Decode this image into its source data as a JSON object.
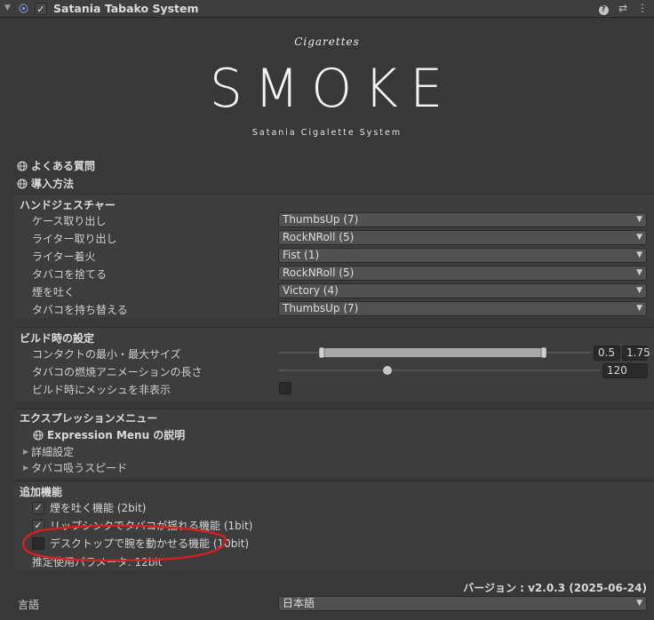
{
  "header": {
    "title": "Satania Tabako System",
    "enabled": true,
    "icons": [
      "help-icon",
      "preset-icon",
      "more-icon"
    ]
  },
  "logo": {
    "script_text": "Cigarettes",
    "main_text": "SMOKE",
    "sub_text": "Satania Cigalette System"
  },
  "links": {
    "faq": "よくある質問",
    "install": "導入方法"
  },
  "hand_gesture": {
    "title": "ハンドジェスチャー",
    "rows": [
      {
        "label": "ケース取り出し",
        "value": "ThumbsUp (7)"
      },
      {
        "label": "ライター取り出し",
        "value": "RockNRoll (5)"
      },
      {
        "label": "ライター着火",
        "value": "Fist (1)"
      },
      {
        "label": "タバコを捨てる",
        "value": "RockNRoll (5)"
      },
      {
        "label": "煙を吐く",
        "value": "Victory (4)"
      },
      {
        "label": "タバコを持ち替える",
        "value": "ThumbsUp (7)"
      }
    ]
  },
  "build": {
    "title": "ビルド時の設定",
    "contact_label": "コンタクトの最小・最大サイズ",
    "contact_min": "0.5",
    "contact_max": "1.75",
    "burn_label": "タバコの燃焼アニメーションの長さ",
    "burn_value": "120",
    "hide_mesh_label": "ビルド時にメッシュを非表示"
  },
  "expression": {
    "title": "エクスプレッションメニュー",
    "menu_link": "Expression Menu の説明",
    "foldouts": [
      "詳細設定",
      "タバコ吸うスピード"
    ]
  },
  "extra": {
    "title": "追加機能",
    "items": [
      {
        "label": "煙を吐く機能 (2bit)",
        "checked": true
      },
      {
        "label": "リップシンクでタバコが揺れる機能 (1bit)",
        "checked": true
      },
      {
        "label": "デスクトップで腕を動かせる機能 (10bit)",
        "checked": false
      }
    ],
    "estimate": "推定使用パラメータ: 12bit"
  },
  "footer": {
    "version": "バージョン : v2.0.3 (2025-06-24)",
    "language_label": "言語",
    "language_value": "日本語"
  },
  "colors": {
    "background": "#383838",
    "annotation": "#d42020"
  }
}
